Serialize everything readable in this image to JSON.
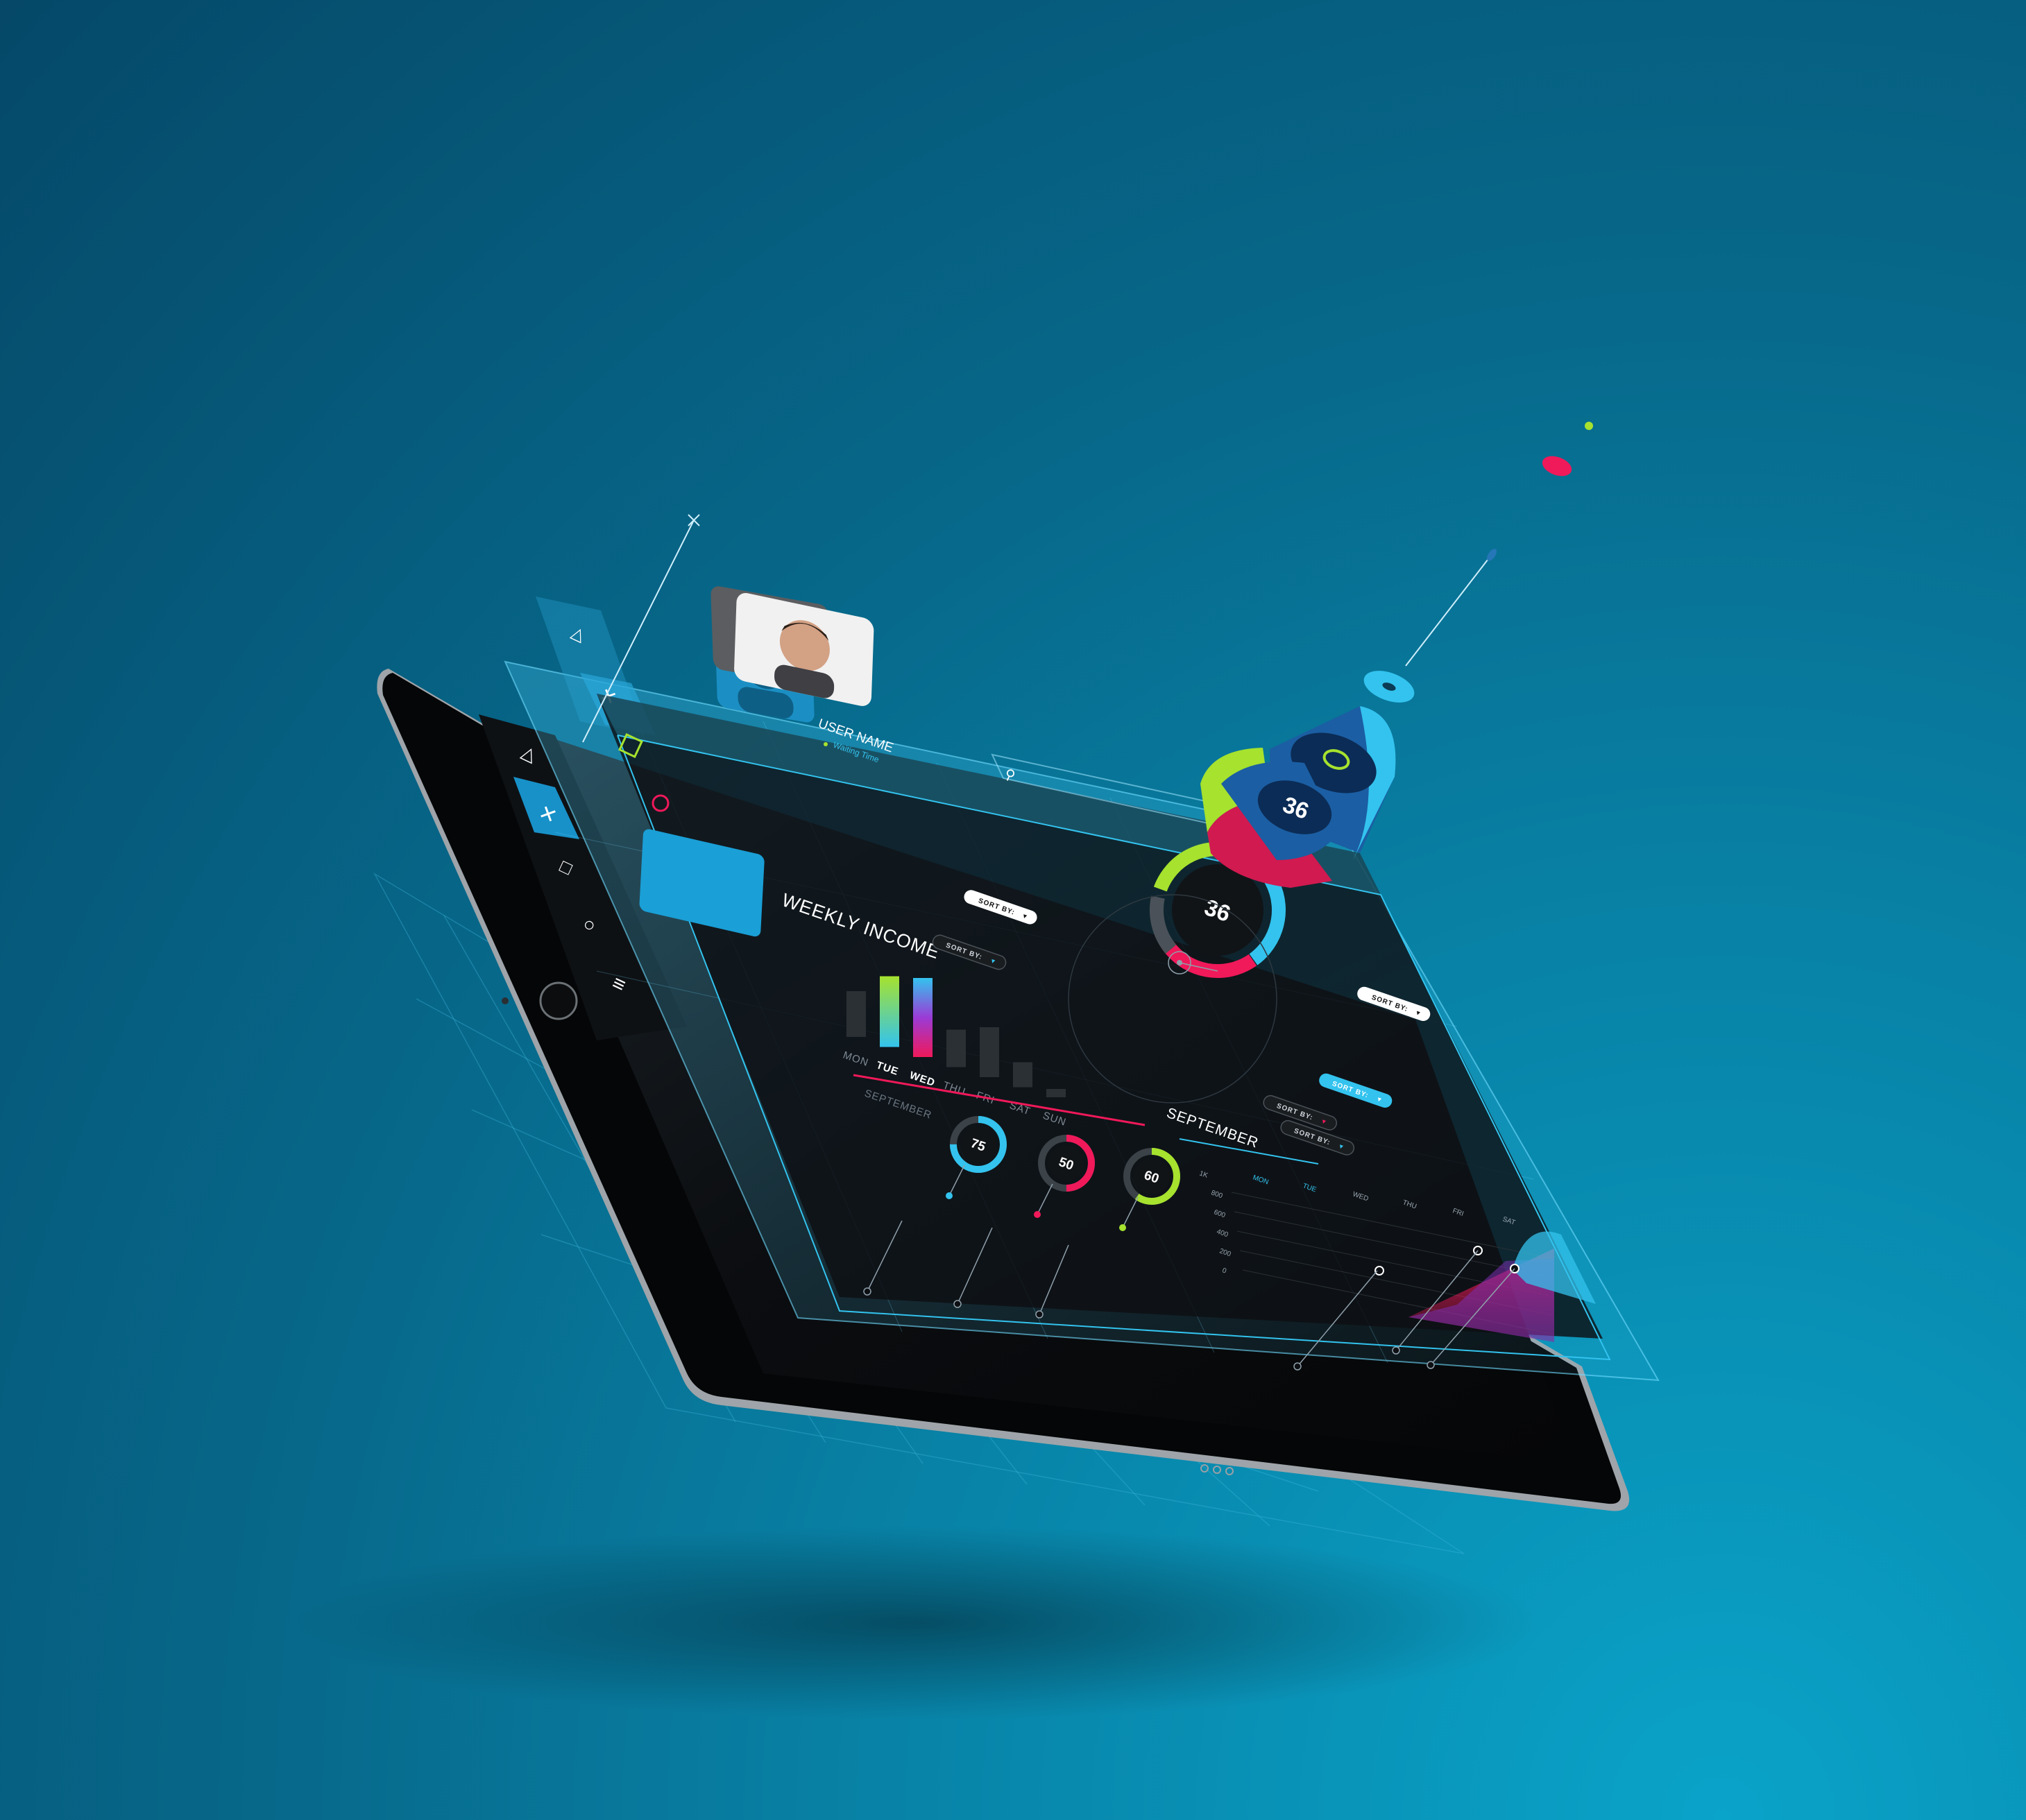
{
  "user": {
    "name": "USER NAME",
    "status": "Waiting Time"
  },
  "sidebar": {
    "icons": [
      "triangle-icon",
      "close-icon",
      "square-icon",
      "circle-icon",
      "menu-icon"
    ]
  },
  "weekly_income": {
    "title": "WEEKLY INCOME",
    "sort_label": "SORT BY:",
    "days": [
      "MON",
      "TUE",
      "WED",
      "THU",
      "FRI",
      "SAT",
      "SUN"
    ],
    "active_days": [
      "TUE",
      "WED"
    ],
    "month": "SEPTEMBER"
  },
  "rings": {
    "small": [
      {
        "label": "75",
        "color": "#33c3ee"
      },
      {
        "label": "50",
        "color": "#f0195a"
      },
      {
        "label": "60",
        "color": "#a6e22e"
      }
    ],
    "large": {
      "label": "36"
    },
    "floating": {
      "label": "36"
    }
  },
  "september_panel": {
    "title": "SEPTEMBER",
    "sort_label": "SORT BY:",
    "days": [
      "MON",
      "TUE",
      "WED",
      "THU",
      "FRI",
      "SAT"
    ],
    "col_header": "1K",
    "y_ticks": [
      "800",
      "600",
      "400",
      "200",
      "0"
    ]
  },
  "colors": {
    "cyan": "#33c3ee",
    "magenta": "#f0195a",
    "lime": "#a6e22e",
    "panel": "#0d0f12"
  },
  "chart_data": [
    {
      "type": "bar",
      "title": "WEEKLY INCOME",
      "categories": [
        "MON",
        "TUE",
        "WED",
        "THU",
        "FRI",
        "SAT",
        "SUN"
      ],
      "values": [
        55,
        85,
        95,
        45,
        60,
        30,
        10
      ],
      "highlighted": [
        "TUE",
        "WED"
      ],
      "xlabel": "",
      "ylabel": ""
    },
    {
      "type": "area",
      "title": "SEPTEMBER",
      "categories": [
        "MON",
        "TUE",
        "WED",
        "THU",
        "FRI",
        "SAT"
      ],
      "y_ticks": [
        800,
        600,
        400,
        200,
        0
      ],
      "series": [
        {
          "values": [
            0,
            0,
            0,
            150,
            300,
            450
          ]
        },
        {
          "values": [
            0,
            0,
            0,
            100,
            350,
            400
          ]
        }
      ]
    }
  ]
}
